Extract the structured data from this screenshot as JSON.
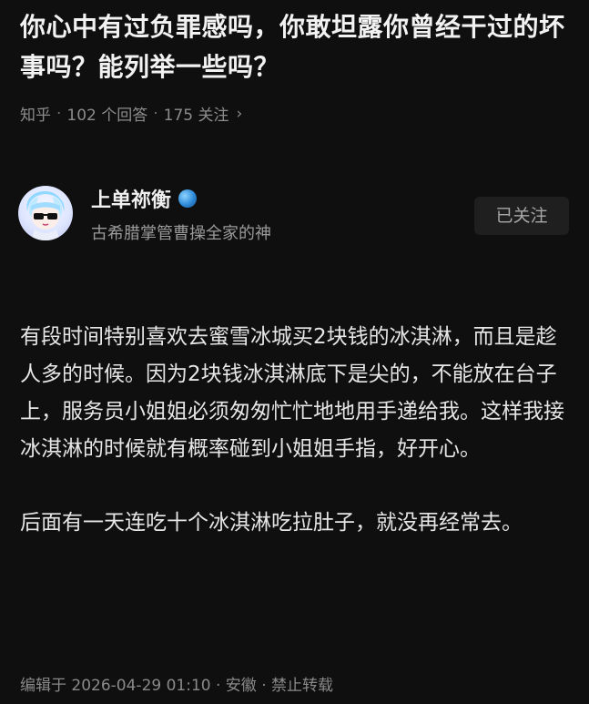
{
  "question": {
    "title": "你心中有过负罪感吗，你敢坦露你曾经干过的坏事吗？能列举一些吗？",
    "source": "知乎",
    "answers": "102 个回答",
    "followers": "175 关注",
    "separator": "·",
    "chevron": "›"
  },
  "author": {
    "name": "上单祢衡",
    "subtitle": "古希腊掌管曹操全家的神",
    "follow_label": "已关注",
    "badge_icon": "globe-badge-icon",
    "avatar_icon": "avatar-character-with-sunglasses"
  },
  "answer": {
    "paragraphs": [
      "有段时间特别喜欢去蜜雪冰城买2块钱的冰淇淋，而且是趁人多的时候。因为2块钱冰淇淋底下是尖的，不能放在台子上，服务员小姐姐必须匆匆忙忙地地用手递给我。这样我接冰淇淋的时候就有概率碰到小姐姐手指，好开心。",
      "后面有一天连吃十个冰淇淋吃拉肚子，就没再经常去。"
    ],
    "footer": "编辑于 2026-04-29 01:10 · 安徽 · 禁止转载"
  },
  "colors": {
    "background": "#0f0f0f",
    "text": "#e6e6e6",
    "muted": "#8a8a8a"
  }
}
